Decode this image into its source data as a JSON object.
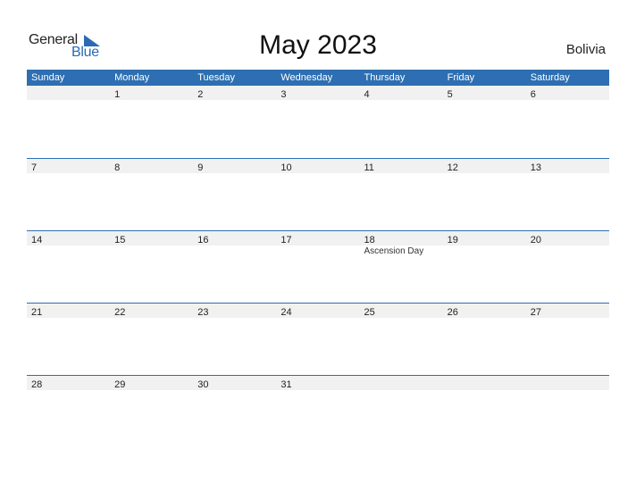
{
  "logo": {
    "text_general": "General",
    "text_blue": "Blue",
    "icon": "triangle-flag-icon"
  },
  "title": "May 2023",
  "country": "Bolivia",
  "colors": {
    "accent": "#2d6fb2",
    "day_strip": "#f1f1f1"
  },
  "weekdays": [
    "Sunday",
    "Monday",
    "Tuesday",
    "Wednesday",
    "Thursday",
    "Friday",
    "Saturday"
  ],
  "weeks": [
    {
      "days": [
        {
          "num": ""
        },
        {
          "num": "1"
        },
        {
          "num": "2"
        },
        {
          "num": "3"
        },
        {
          "num": "4"
        },
        {
          "num": "5"
        },
        {
          "num": "6"
        }
      ]
    },
    {
      "days": [
        {
          "num": "7"
        },
        {
          "num": "8"
        },
        {
          "num": "9"
        },
        {
          "num": "10"
        },
        {
          "num": "11"
        },
        {
          "num": "12"
        },
        {
          "num": "13"
        }
      ]
    },
    {
      "days": [
        {
          "num": "14"
        },
        {
          "num": "15"
        },
        {
          "num": "16"
        },
        {
          "num": "17"
        },
        {
          "num": "18",
          "event": "Ascension Day"
        },
        {
          "num": "19"
        },
        {
          "num": "20"
        }
      ]
    },
    {
      "days": [
        {
          "num": "21"
        },
        {
          "num": "22"
        },
        {
          "num": "23"
        },
        {
          "num": "24"
        },
        {
          "num": "25"
        },
        {
          "num": "26"
        },
        {
          "num": "27"
        }
      ]
    },
    {
      "days": [
        {
          "num": "28"
        },
        {
          "num": "29"
        },
        {
          "num": "30"
        },
        {
          "num": "31"
        },
        {
          "num": ""
        },
        {
          "num": ""
        },
        {
          "num": ""
        }
      ]
    }
  ]
}
